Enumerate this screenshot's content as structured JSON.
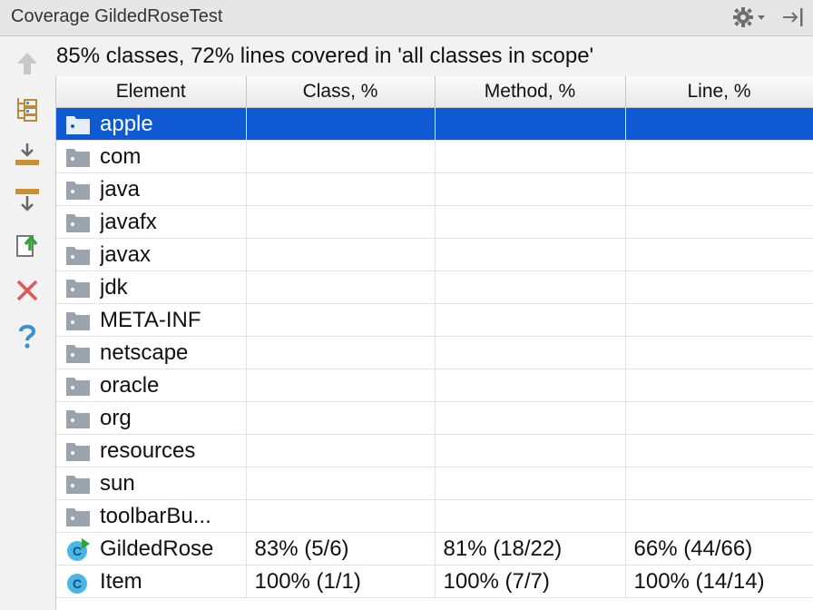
{
  "window": {
    "title": "Coverage GildedRoseTest"
  },
  "summary": "85% classes, 72% lines covered in 'all classes in scope'",
  "toolbar": {
    "tools": [
      {
        "name": "up-arrow-icon",
        "enabled": false
      },
      {
        "name": "flatten-packages-icon",
        "enabled": true
      },
      {
        "name": "import-icon",
        "enabled": true
      },
      {
        "name": "autoscroll-icon",
        "enabled": true
      },
      {
        "name": "export-report-icon",
        "enabled": true
      },
      {
        "name": "close-icon",
        "enabled": true
      },
      {
        "name": "help-icon",
        "enabled": true
      }
    ]
  },
  "table": {
    "columns": [
      "Element",
      "Class, %",
      "Method, %",
      "Line, %"
    ],
    "rows": [
      {
        "icon": "folder-icon",
        "element": "apple",
        "class_pct": "",
        "method_pct": "",
        "line_pct": "",
        "selected": true
      },
      {
        "icon": "folder-icon",
        "element": "com",
        "class_pct": "",
        "method_pct": "",
        "line_pct": ""
      },
      {
        "icon": "folder-icon",
        "element": "java",
        "class_pct": "",
        "method_pct": "",
        "line_pct": ""
      },
      {
        "icon": "folder-icon",
        "element": "javafx",
        "class_pct": "",
        "method_pct": "",
        "line_pct": ""
      },
      {
        "icon": "folder-icon",
        "element": "javax",
        "class_pct": "",
        "method_pct": "",
        "line_pct": ""
      },
      {
        "icon": "folder-icon",
        "element": "jdk",
        "class_pct": "",
        "method_pct": "",
        "line_pct": ""
      },
      {
        "icon": "folder-icon",
        "element": "META-INF",
        "class_pct": "",
        "method_pct": "",
        "line_pct": ""
      },
      {
        "icon": "folder-icon",
        "element": "netscape",
        "class_pct": "",
        "method_pct": "",
        "line_pct": ""
      },
      {
        "icon": "folder-icon",
        "element": "oracle",
        "class_pct": "",
        "method_pct": "",
        "line_pct": ""
      },
      {
        "icon": "folder-icon",
        "element": "org",
        "class_pct": "",
        "method_pct": "",
        "line_pct": ""
      },
      {
        "icon": "folder-icon",
        "element": "resources",
        "class_pct": "",
        "method_pct": "",
        "line_pct": ""
      },
      {
        "icon": "folder-icon",
        "element": "sun",
        "class_pct": "",
        "method_pct": "",
        "line_pct": ""
      },
      {
        "icon": "folder-icon",
        "element": "toolbarBu...",
        "class_pct": "",
        "method_pct": "",
        "line_pct": ""
      },
      {
        "icon": "class-runnable-icon",
        "element": "GildedRose",
        "class_pct": "83% (5/6)",
        "method_pct": "81% (18/22)",
        "line_pct": "66% (44/66)"
      },
      {
        "icon": "class-icon",
        "element": "Item",
        "class_pct": "100% (1/1)",
        "method_pct": "100% (7/7)",
        "line_pct": "100% (14/14)"
      }
    ]
  },
  "colors": {
    "selection": "#0f5ad2",
    "folder": "#9aa4ae",
    "class_icon": "#49b6e6",
    "run_marker": "#2fa43a",
    "close_red": "#e05555",
    "help_blue": "#3d8fd6"
  }
}
